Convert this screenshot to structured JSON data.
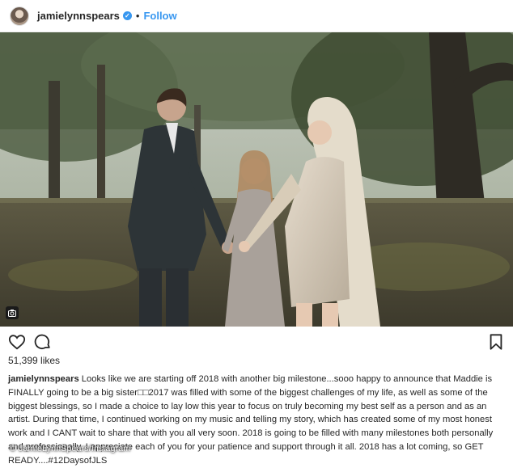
{
  "post": {
    "username": "jamielynnspears",
    "separator": "•",
    "follow_label": "Follow",
    "likes": "51,399 likes",
    "caption_user": "jamielynnspears",
    "caption_text": "Looks like we are starting off 2018 with another big milestone...sooo happy to announce that Maddie is FINALLY going to be a big sister□□2017 was filled with some of the biggest challenges of my life, as well as some of the biggest blessings, so I made a choice to lay low this year to focus on truly becoming my best self as a person and as an artist. During that time, I continued working on my music and telling my story, which has created some of my most honest work and I CANT wait to share that with you all very soon. 2018 is going to be filled with many milestones both personally and professionally. I appreciate each of you for your patience and support through it all. 2018 has a lot coming, so GET READY....#12DaysofJLS",
    "photo_credit": "© JamieLynnSpears/Instagram"
  },
  "icons": {
    "verified": "verified-badge-icon",
    "like": "heart-icon",
    "comment": "comment-icon",
    "save": "bookmark-icon",
    "media": "camera-icon"
  },
  "colors": {
    "accent": "#3897f0",
    "text": "#262626"
  }
}
